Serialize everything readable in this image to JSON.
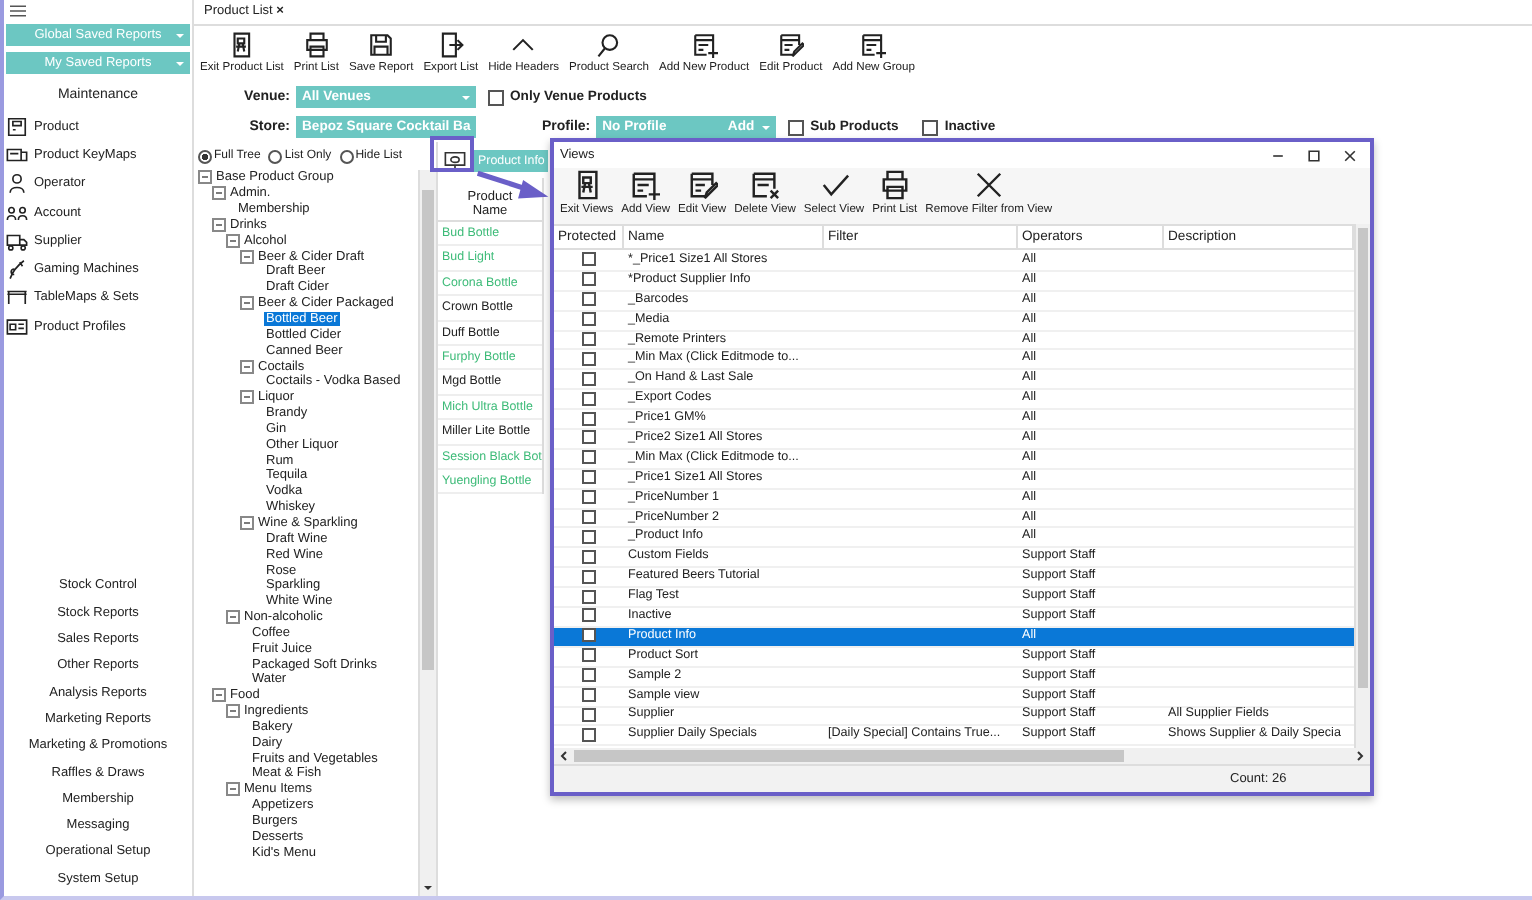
{
  "sidebar": {
    "saved_reports": [
      {
        "label": "Global Saved Reports"
      },
      {
        "label": "My Saved Reports"
      }
    ],
    "section_title": "Maintenance",
    "items": [
      {
        "label": "Product"
      },
      {
        "label": "Product KeyMaps"
      },
      {
        "label": "Operator"
      },
      {
        "label": "Account"
      },
      {
        "label": "Supplier"
      },
      {
        "label": "Gaming Machines"
      },
      {
        "label": "TableMaps & Sets"
      },
      {
        "label": "Product Profiles"
      }
    ],
    "bottom_items": [
      "Stock Control",
      "Stock Reports",
      "Sales Reports",
      "Other Reports",
      "Analysis Reports",
      "Marketing Reports",
      "Marketing & Promotions",
      "Raffles & Draws",
      "Membership",
      "Messaging",
      "Operational Setup",
      "System Setup"
    ]
  },
  "tab": {
    "label": "Product List",
    "close": "×"
  },
  "toolbar": [
    "Exit Product List",
    "Print List",
    "Save Report",
    "Export List",
    "Hide Headers",
    "Product Search",
    "Add New Product",
    "Edit Product",
    "Add New Group"
  ],
  "filters": {
    "venue": {
      "label": "Venue:",
      "value": "All Venues"
    },
    "only_venue_products": {
      "label": "Only Venue Products",
      "checked": false
    },
    "store": {
      "label": "Store:",
      "value": "Bepoz Square Cocktail Ba"
    },
    "profile": {
      "label": "Profile:",
      "value": "No Profile",
      "add": "Add"
    },
    "sub_products": {
      "label": "Sub Products",
      "checked": false
    },
    "inactive": {
      "label": "Inactive",
      "checked": false
    }
  },
  "tree_modes": [
    {
      "label": "Full Tree",
      "selected": true
    },
    {
      "label": "List Only",
      "selected": false
    },
    {
      "label": "Hide List",
      "selected": false
    }
  ],
  "tree": [
    {
      "label": "Base Product Group",
      "expanded": true,
      "selected": false,
      "children": [
        {
          "label": "Admin.",
          "expanded": true,
          "selected": false,
          "children": [
            {
              "label": "Membership",
              "selected": false
            }
          ]
        },
        {
          "label": "Drinks",
          "expanded": true,
          "selected": false,
          "children": [
            {
              "label": "Alcohol",
              "expanded": true,
              "selected": false,
              "children": [
                {
                  "label": "Beer & Cider Draft",
                  "expanded": true,
                  "selected": false,
                  "children": [
                    {
                      "label": "Draft Beer",
                      "selected": false
                    },
                    {
                      "label": "Draft Cider",
                      "selected": false
                    }
                  ]
                },
                {
                  "label": "Beer & Cider Packaged",
                  "expanded": true,
                  "selected": false,
                  "children": [
                    {
                      "label": "Bottled Beer",
                      "selected": true
                    },
                    {
                      "label": "Bottled Cider",
                      "selected": false
                    },
                    {
                      "label": "Canned Beer",
                      "selected": false
                    }
                  ]
                },
                {
                  "label": "Coctails",
                  "expanded": true,
                  "selected": false,
                  "children": [
                    {
                      "label": "Coctails - Vodka Based",
                      "selected": false
                    }
                  ]
                },
                {
                  "label": "Liquor",
                  "expanded": true,
                  "selected": false,
                  "children": [
                    {
                      "label": "Brandy",
                      "selected": false
                    },
                    {
                      "label": "Gin",
                      "selected": false
                    },
                    {
                      "label": "Other Liquor",
                      "selected": false
                    },
                    {
                      "label": "Rum",
                      "selected": false
                    },
                    {
                      "label": "Tequila",
                      "selected": false
                    },
                    {
                      "label": "Vodka",
                      "selected": false
                    },
                    {
                      "label": "Whiskey",
                      "selected": false
                    }
                  ]
                },
                {
                  "label": "Wine & Sparkling",
                  "expanded": true,
                  "selected": false,
                  "children": [
                    {
                      "label": "Draft Wine",
                      "selected": false
                    },
                    {
                      "label": "Red Wine",
                      "selected": false
                    },
                    {
                      "label": "Rose",
                      "selected": false
                    },
                    {
                      "label": "Sparkling",
                      "selected": false
                    },
                    {
                      "label": "White Wine",
                      "selected": false
                    }
                  ]
                }
              ]
            },
            {
              "label": "Non-alcoholic",
              "expanded": true,
              "selected": false,
              "children": [
                {
                  "label": "Coffee",
                  "selected": false
                },
                {
                  "label": "Fruit Juice",
                  "selected": false
                },
                {
                  "label": "Packaged Soft Drinks",
                  "selected": false
                },
                {
                  "label": "Water",
                  "selected": false
                }
              ]
            }
          ]
        },
        {
          "label": "Food",
          "expanded": true,
          "selected": false,
          "children": [
            {
              "label": "Ingredients",
              "expanded": true,
              "selected": false,
              "children": [
                {
                  "label": "Bakery",
                  "selected": false
                },
                {
                  "label": "Dairy",
                  "selected": false
                },
                {
                  "label": "Fruits and Vegetables",
                  "selected": false
                },
                {
                  "label": "Meat & Fish",
                  "selected": false
                }
              ]
            },
            {
              "label": "Menu Items",
              "expanded": true,
              "selected": false,
              "children": [
                {
                  "label": "Appetizers",
                  "selected": false
                },
                {
                  "label": "Burgers",
                  "selected": false
                },
                {
                  "label": "Desserts",
                  "selected": false
                },
                {
                  "label": "Kid's Menu",
                  "selected": false
                }
              ]
            }
          ]
        }
      ]
    }
  ],
  "view_tab": "Product Info",
  "product_column": "Product Name",
  "products": [
    {
      "name": "Bud Bottle",
      "color": "#3dbb78"
    },
    {
      "name": "Bud Light",
      "color": "#3dbb78"
    },
    {
      "name": "Corona Bottle",
      "color": "#3dbb78"
    },
    {
      "name": "Crown Bottle",
      "color": "#222222"
    },
    {
      "name": "Duff Bottle",
      "color": "#222222"
    },
    {
      "name": "Furphy Bottle",
      "color": "#3dbb78"
    },
    {
      "name": "Mgd Bottle",
      "color": "#222222"
    },
    {
      "name": "Mich Ultra Bottle",
      "color": "#3dbb78"
    },
    {
      "name": "Miller Lite Bottle",
      "color": "#222222"
    },
    {
      "name": "Session Black Bot",
      "color": "#3dbb78"
    },
    {
      "name": "Yuengling Bottle",
      "color": "#3dbb78"
    }
  ],
  "views": {
    "title": "Views",
    "toolbar": [
      "Exit Views",
      "Add View",
      "Edit View",
      "Delete View",
      "Select View",
      "Print List",
      "Remove Filter from View"
    ],
    "columns": [
      "Protected",
      "Name",
      "Filter",
      "Operators",
      "Description"
    ],
    "rows": [
      {
        "protected": false,
        "selected": false,
        "name": "*_Price1 Size1 All Stores",
        "operators": "All"
      },
      {
        "protected": false,
        "selected": false,
        "name": "*Product Supplier Info",
        "operators": "All"
      },
      {
        "protected": false,
        "selected": false,
        "name": "_Barcodes",
        "operators": "All"
      },
      {
        "protected": false,
        "selected": false,
        "name": "_Media",
        "operators": "All"
      },
      {
        "protected": false,
        "selected": false,
        "name": "_Remote Printers",
        "operators": "All"
      },
      {
        "protected": false,
        "selected": false,
        "name": "_Min Max (Click Editmode to...",
        "operators": "All"
      },
      {
        "protected": false,
        "selected": false,
        "name": "_On Hand & Last Sale",
        "operators": "All"
      },
      {
        "protected": false,
        "selected": false,
        "name": "_Export Codes",
        "operators": "All"
      },
      {
        "protected": false,
        "selected": false,
        "name": "_Price1 GM%",
        "operators": "All"
      },
      {
        "protected": false,
        "selected": false,
        "name": "_Price2 Size1 All Stores",
        "operators": "All"
      },
      {
        "protected": false,
        "selected": false,
        "name": "_Min Max (Click Editmode to...",
        "operators": "All"
      },
      {
        "protected": false,
        "selected": false,
        "name": "_Price1 Size1 All Stores",
        "operators": "All"
      },
      {
        "protected": false,
        "selected": false,
        "name": "_PriceNumber 1",
        "operators": "All"
      },
      {
        "protected": false,
        "selected": false,
        "name": "_PriceNumber 2",
        "operators": "All"
      },
      {
        "protected": false,
        "selected": false,
        "name": "_Product Info",
        "operators": "All"
      },
      {
        "protected": false,
        "selected": false,
        "name": "Custom Fields",
        "operators": "Support Staff"
      },
      {
        "protected": false,
        "selected": false,
        "name": "Featured Beers Tutorial",
        "operators": "Support Staff"
      },
      {
        "protected": false,
        "selected": false,
        "name": "Flag Test",
        "operators": "Support Staff"
      },
      {
        "protected": false,
        "selected": false,
        "name": "Inactive",
        "operators": "Support Staff"
      },
      {
        "protected": false,
        "selected": true,
        "name": "Product Info",
        "operators": "All"
      },
      {
        "protected": false,
        "selected": false,
        "name": "Product Sort",
        "operators": "Support Staff"
      },
      {
        "protected": false,
        "selected": false,
        "name": "Sample 2",
        "operators": "Support Staff"
      },
      {
        "protected": false,
        "selected": false,
        "name": "Sample view",
        "operators": "Support Staff"
      },
      {
        "protected": false,
        "selected": false,
        "name": "Supplier",
        "operators": "Support Staff",
        "description": "All Supplier Fields"
      },
      {
        "protected": false,
        "selected": false,
        "name": "Supplier Daily Specials",
        "filter": "[Daily Special] Contains True...",
        "operators": "Support Staff",
        "description": "Shows Supplier & Daily Specia"
      }
    ],
    "count": "Count: 26"
  }
}
